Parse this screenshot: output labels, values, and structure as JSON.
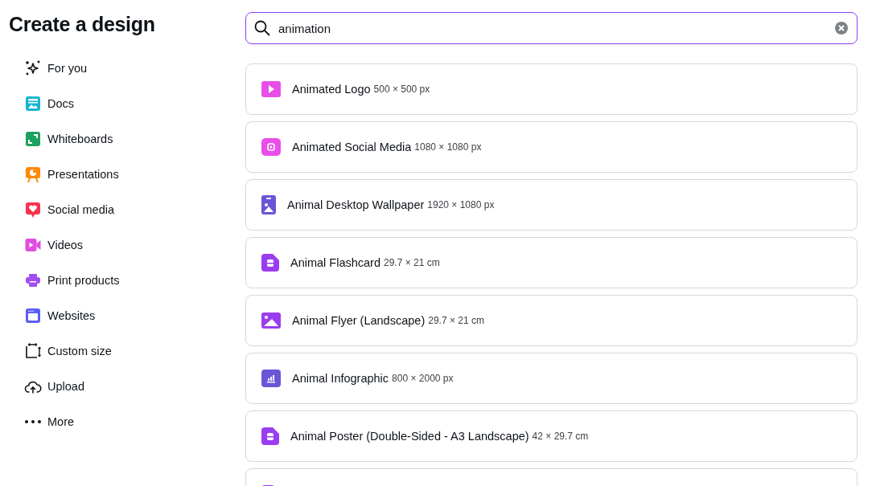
{
  "heading": "Create a design",
  "sidebar": {
    "items": [
      {
        "label": "For you",
        "kind": "sparkles"
      },
      {
        "label": "Docs",
        "kind": "docs"
      },
      {
        "label": "Whiteboards",
        "kind": "whiteboard"
      },
      {
        "label": "Presentations",
        "kind": "presentation"
      },
      {
        "label": "Social media",
        "kind": "social"
      },
      {
        "label": "Videos",
        "kind": "video"
      },
      {
        "label": "Print products",
        "kind": "print"
      },
      {
        "label": "Websites",
        "kind": "website"
      },
      {
        "label": "Custom size",
        "kind": "resize"
      },
      {
        "label": "Upload",
        "kind": "upload"
      },
      {
        "label": "More",
        "kind": "more"
      }
    ]
  },
  "search": {
    "value": "animation"
  },
  "results": [
    {
      "name": "Animated Logo",
      "size": "500 × 500 px",
      "kind": "play"
    },
    {
      "name": "Animated Social Media",
      "size": "1080 × 1080 px",
      "kind": "social"
    },
    {
      "name": "Animal Desktop Wallpaper",
      "size": "1920 × 1080 px",
      "kind": "phone"
    },
    {
      "name": "Animal Flashcard",
      "size": "29.7 × 21 cm",
      "kind": "print"
    },
    {
      "name": "Animal Flyer (Landscape)",
      "size": "29.7 × 21 cm",
      "kind": "image"
    },
    {
      "name": "Animal Infographic",
      "size": "800 × 2000 px",
      "kind": "chart"
    },
    {
      "name": "Animal Poster (Double-Sided - A3 Landscape)",
      "size": "42 × 29.7 cm",
      "kind": "print"
    },
    {
      "kind": "print"
    }
  ]
}
